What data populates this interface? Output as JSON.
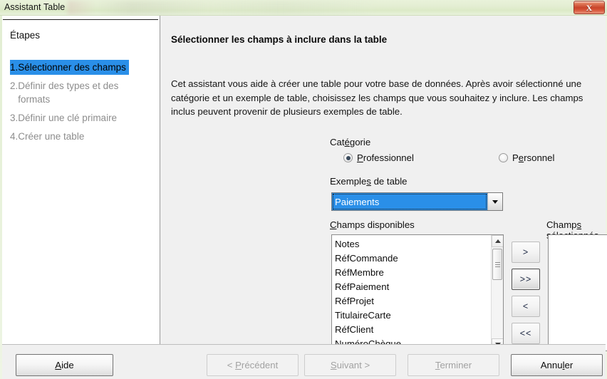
{
  "window": {
    "title": "Assistant Table",
    "close_label": "X"
  },
  "sidebar": {
    "title": "Étapes",
    "steps": [
      {
        "num": "1.",
        "label": "Sélectionner des champs",
        "active": true
      },
      {
        "num": "2.",
        "label": "Définir des types et des formats",
        "active": false
      },
      {
        "num": "3.",
        "label": "Définir une clé primaire",
        "active": false
      },
      {
        "num": "4.",
        "label": "Créer une table",
        "active": false
      }
    ]
  },
  "main": {
    "heading": "Sélectionner les champs à inclure dans la table",
    "description": "Cet assistant vous aide à créer une table pour votre base de données. Après avoir sélectionné une catégorie et un exemple de table, choisissez les champs que vous souhaitez y inclure. Les champs inclus peuvent provenir de plusieurs exemples de table.",
    "category": {
      "label": "Catégorie",
      "options": [
        {
          "label": "Professionnel",
          "selected": true
        },
        {
          "label": "Personnel",
          "selected": false
        }
      ]
    },
    "table_examples": {
      "label": "Exemples de table",
      "value": "Paiements"
    },
    "available_fields": {
      "label": "Champs disponibles",
      "items": [
        "Notes",
        "RéfCommande",
        "RéfMembre",
        "RéfPaiement",
        "RéfProjet",
        "TitulaireCarte",
        "RéfClient",
        "NuméroChèque"
      ]
    },
    "selected_fields": {
      "label": "Champs sélectionnés",
      "items": []
    },
    "transfer_buttons": {
      "add_one": ">",
      "add_all": ">>",
      "remove_one": "<",
      "remove_all": "<<"
    },
    "order_buttons": {
      "up": "∧",
      "down": "∨"
    }
  },
  "footer": {
    "help": "Aide",
    "back": "< Précédent",
    "next": "Suivant >",
    "finish": "Terminer",
    "cancel": "Annuler"
  },
  "colors": {
    "titlebar_green": "#e4eed3",
    "highlight_blue": "#2a8fe8",
    "close_red": "#c9442a",
    "panel_gray": "#f0f0f0"
  }
}
